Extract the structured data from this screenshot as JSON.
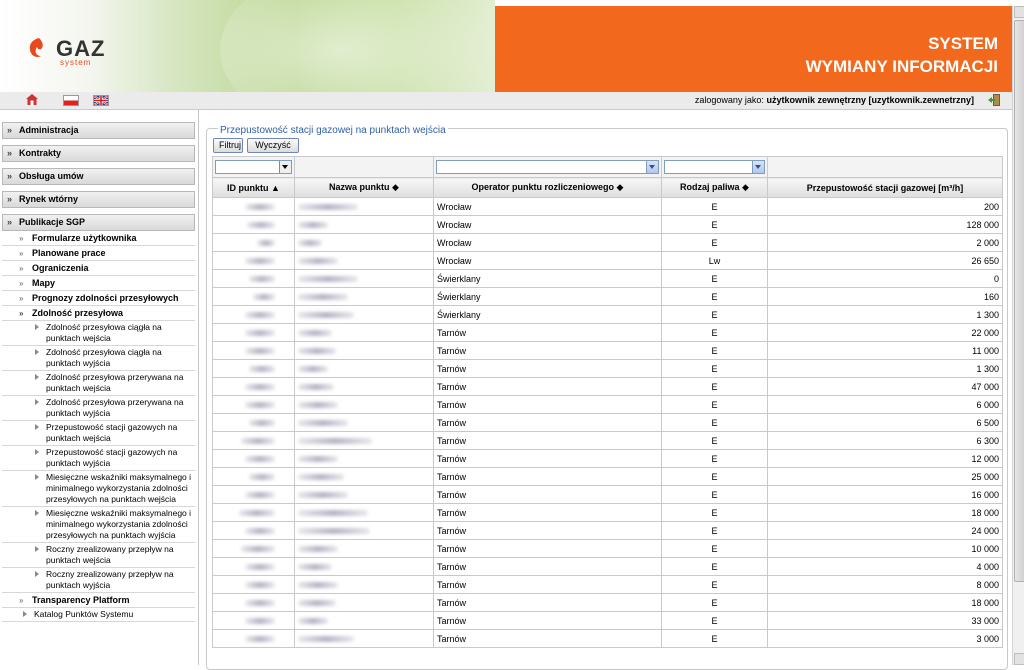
{
  "header": {
    "logo_text": "GAZ",
    "logo_sub": "system",
    "title_line1": "SYSTEM",
    "title_line2": "WYMIANY INFORMACJI"
  },
  "topbar": {
    "user_prefix": "zalogowany jako:",
    "user_name": "użytkownik zewnętrzny [uzytkownik.zewnetrzny]"
  },
  "sidebar": {
    "sections": [
      "Administracja",
      "Kontrakty",
      "Obsługa umów",
      "Rynek wtórny",
      "Publikacje SGP"
    ],
    "sub_items": [
      "Formularze użytkownika",
      "Planowane prace",
      "Ograniczenia",
      "Mapy",
      "Prognozy zdolności przesyłowych",
      "Zdolność przesyłowa"
    ],
    "leaf_items": [
      "Zdolność przesyłowa ciągła na punktach wejścia",
      "Zdolność przesyłowa ciągła na punktach wyjścia",
      "Zdolność przesyłowa przerywana na punktach wejścia",
      "Zdolność przesyłowa przerywana na punktach wyjścia",
      "Przepustowość stacji gazowych na punktach wejścia",
      "Przepustowość stacji gazowych na punktach wyjścia",
      "Miesięczne wskaźniki maksymalnego i minimalnego wykorzystania zdolności przesyłowych na punktach wejścia",
      "Miesięczne wskaźniki maksymalnego i minimalnego wykorzystania zdolności przesyłowych na punktach wyjścia",
      "Roczny zrealizowany przepływ na punktach wejścia",
      "Roczny zrealizowany przepływ na punktach wyjścia"
    ],
    "transparency": "Transparency Platform",
    "catalog": "Katalog Punktów Systemu"
  },
  "main": {
    "legend": "Przepustowość stacji gazowej na punktach wejścia",
    "filter_btn": "Filtruj",
    "clear_btn": "Wyczyść",
    "columns": [
      "ID punktu ▲",
      "Nazwa punktu ◆",
      "Operator punktu rozliczeniowego ◆",
      "Rodzaj paliwa ◆",
      "Przepustowość stacji gazowej [m³/h]"
    ],
    "rows": [
      {
        "op": "Wrocław",
        "fuel": "E",
        "cap": "200"
      },
      {
        "op": "Wrocław",
        "fuel": "E",
        "cap": "128 000"
      },
      {
        "op": "Wrocław",
        "fuel": "E",
        "cap": "2 000"
      },
      {
        "op": "Wrocław",
        "fuel": "Lw",
        "cap": "26 650"
      },
      {
        "op": "Świerklany",
        "fuel": "E",
        "cap": "0"
      },
      {
        "op": "Świerklany",
        "fuel": "E",
        "cap": "160"
      },
      {
        "op": "Świerklany",
        "fuel": "E",
        "cap": "1 300"
      },
      {
        "op": "Tarnów",
        "fuel": "E",
        "cap": "22 000"
      },
      {
        "op": "Tarnów",
        "fuel": "E",
        "cap": "11 000"
      },
      {
        "op": "Tarnów",
        "fuel": "E",
        "cap": "1 300"
      },
      {
        "op": "Tarnów",
        "fuel": "E",
        "cap": "47 000"
      },
      {
        "op": "Tarnów",
        "fuel": "E",
        "cap": "6 000"
      },
      {
        "op": "Tarnów",
        "fuel": "E",
        "cap": "6 500"
      },
      {
        "op": "Tarnów",
        "fuel": "E",
        "cap": "6 300"
      },
      {
        "op": "Tarnów",
        "fuel": "E",
        "cap": "12 000"
      },
      {
        "op": "Tarnów",
        "fuel": "E",
        "cap": "25 000"
      },
      {
        "op": "Tarnów",
        "fuel": "E",
        "cap": "16 000"
      },
      {
        "op": "Tarnów",
        "fuel": "E",
        "cap": "18 000"
      },
      {
        "op": "Tarnów",
        "fuel": "E",
        "cap": "24 000"
      },
      {
        "op": "Tarnów",
        "fuel": "E",
        "cap": "10 000"
      },
      {
        "op": "Tarnów",
        "fuel": "E",
        "cap": "4 000"
      },
      {
        "op": "Tarnów",
        "fuel": "E",
        "cap": "8 000"
      },
      {
        "op": "Tarnów",
        "fuel": "E",
        "cap": "18 000"
      },
      {
        "op": "Tarnów",
        "fuel": "E",
        "cap": "33 000"
      },
      {
        "op": "Tarnów",
        "fuel": "E",
        "cap": "3 000"
      }
    ]
  },
  "colors": {
    "accent_orange": "#f2691e",
    "legend_blue": "#2f5fa8"
  }
}
